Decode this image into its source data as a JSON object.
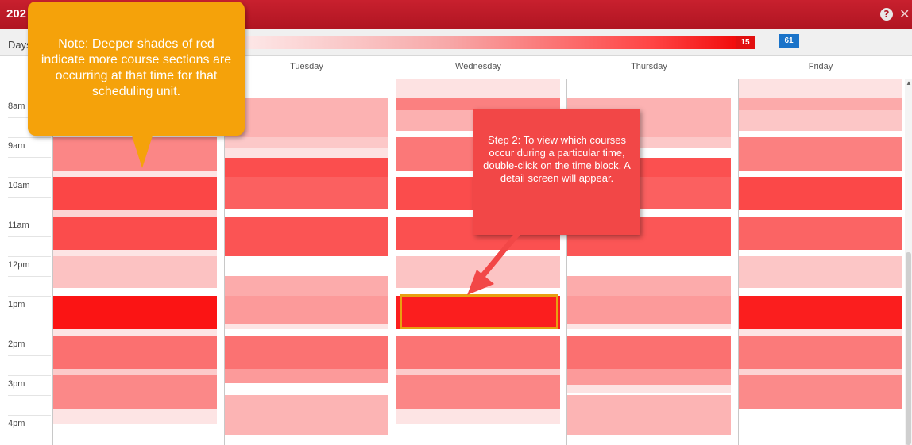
{
  "window": {
    "title": "202",
    "help_icon": "help-icon",
    "close_icon": "close-icon"
  },
  "filter": {
    "days_label": "Days",
    "max_badge": "15",
    "total_badge": "61"
  },
  "days": [
    "Tuesday",
    "Wednesday",
    "Thursday",
    "Friday"
  ],
  "hours": [
    "8am",
    "9am",
    "10am",
    "11am",
    "12pm",
    "1pm",
    "2pm",
    "3pm",
    "4pm"
  ],
  "note": {
    "text": "Note: Deeper shades of red indicate more course sections are occurring at that time for that scheduling unit."
  },
  "step": {
    "text": "Step 2: To view which courses occur during a particular time, double-click on the time block. A detail screen will appear."
  },
  "colors": {
    "title_bar": "#b01522",
    "note_bg": "#f5a20a",
    "step_bg": "#f24747",
    "highlight_border": "#e8a010",
    "max_badge": "#e21010",
    "total_badge": "#1a73c9"
  }
}
